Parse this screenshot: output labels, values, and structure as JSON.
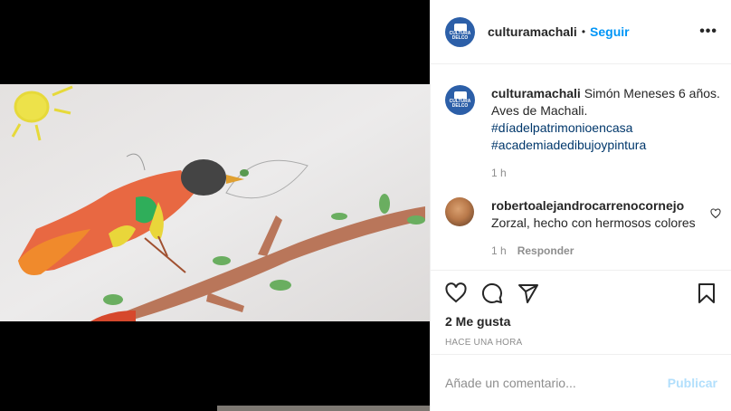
{
  "post": {
    "username": "culturamachali",
    "follow_label": "Seguir",
    "separator": "•",
    "more_label": "•••",
    "avatar_text": "CULTURA DELCO"
  },
  "caption": {
    "username": "culturamachali",
    "text": " Simón Meneses 6 años. Aves de Machali.",
    "hashtag1": "#díadelpatrimonioencasa",
    "hashtag2": "#academiadedibujoypintura",
    "time": "1 h"
  },
  "comment": {
    "username": "robertoalejandrocarrenocornejo",
    "text": "Zorzal, hecho con hermosos colores",
    "time": "1 h",
    "reply_label": "Responder"
  },
  "actions": {
    "likes": "2 Me gusta",
    "timestamp": "Hace una hora"
  },
  "add_comment": {
    "placeholder": "Añade un comentario...",
    "publish_label": "Publicar"
  },
  "colors": {
    "link": "#0095f6",
    "hashtag": "#00376b",
    "muted": "#8e8e8e",
    "publish_disabled": "#b2dffc"
  },
  "icons": [
    "heart-icon",
    "comment-icon",
    "share-icon",
    "bookmark-icon",
    "more-icon"
  ]
}
